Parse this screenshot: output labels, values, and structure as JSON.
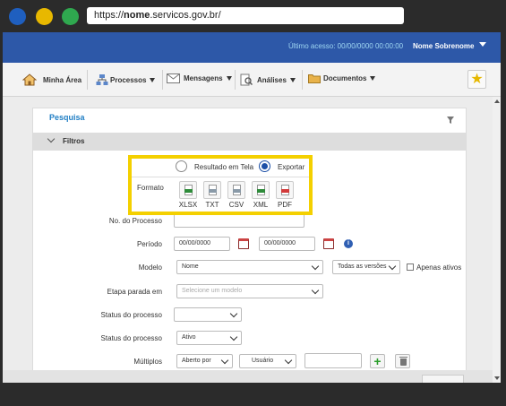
{
  "browser": {
    "url_prefix": "https://",
    "url_domain": "nome",
    "url_suffix": ".servicos.gov.br/",
    "traffic_colors": [
      "#1f5fbf",
      "#e8b800",
      "#2fa84f"
    ]
  },
  "header": {
    "last_access": "Último acesso: 00/00/0000 00:00:00",
    "user_name": "Nome Sobrenome"
  },
  "nav": {
    "items": [
      {
        "label": "Minha Área",
        "icon": "home-icon"
      },
      {
        "label": "Processos",
        "icon": "processes-icon"
      },
      {
        "label": "Mensagens",
        "icon": "mail-icon"
      },
      {
        "label": "Análises",
        "icon": "analysis-icon"
      },
      {
        "label": "Documentos",
        "icon": "folder-icon"
      }
    ],
    "favorite_icon": "star-icon"
  },
  "card": {
    "title": "Pesquisa",
    "section": "Filtros"
  },
  "popup": {
    "option_screen": "Resultado em Tela",
    "option_export": "Exportar",
    "selected": "Exportar",
    "format_label": "Formato",
    "formats": [
      {
        "label": "XLSX",
        "color": "#2e8b3a"
      },
      {
        "label": "TXT",
        "color": "#8a9aa8"
      },
      {
        "label": "CSV",
        "color": "#8a9aa8"
      },
      {
        "label": "XML",
        "color": "#2e8b3a"
      },
      {
        "label": "PDF",
        "color": "#d23a3a"
      }
    ]
  },
  "form": {
    "process_no_label": "No. do Processo",
    "period_label": "Período",
    "period_from": "00/00/0000",
    "period_to": "00/00/0000",
    "model_label": "Modelo",
    "model_value": "Nome",
    "versions_value": "Todas as versões",
    "only_active_label": "Apenas ativos",
    "stage_label": "Etapa parada em",
    "stage_placeholder": "Selecione um modelo",
    "status1_label": "Status do processo",
    "status2_label": "Status do processo",
    "status2_value": "Ativo",
    "multiple_label": "Múltiplos",
    "multiple_value1": "Aberto por",
    "multiple_value2": "Usuário"
  },
  "colors": {
    "topbar": "#2d58a8",
    "accent_title": "#1f7ec4",
    "highlight_border": "#f4d000"
  }
}
